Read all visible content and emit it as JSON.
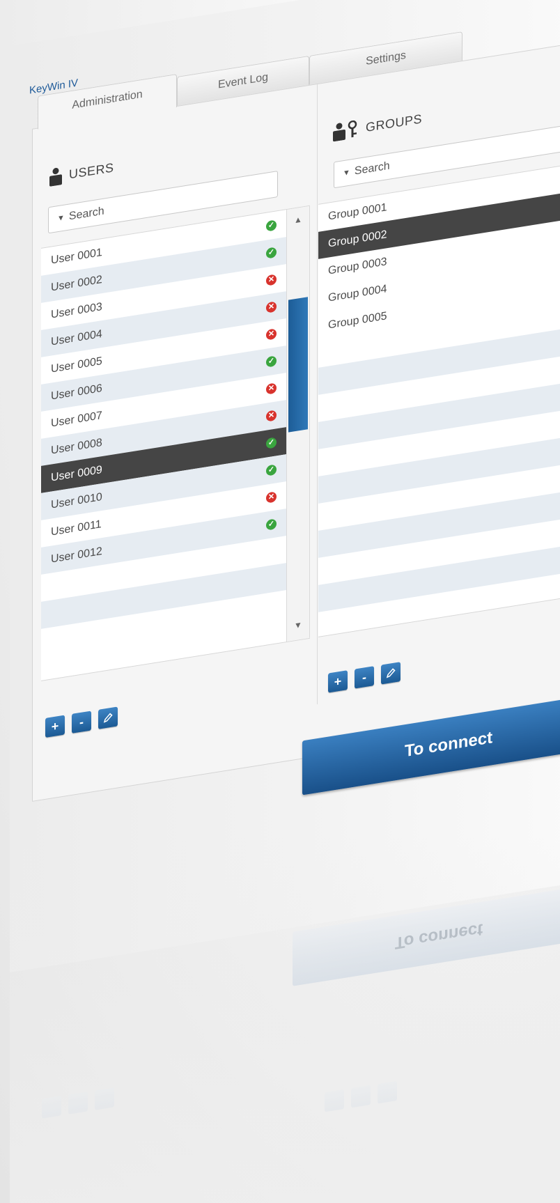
{
  "app": {
    "title": "KeyWin IV"
  },
  "tabs": [
    {
      "label": "Administration",
      "active": true
    },
    {
      "label": "Event Log",
      "active": false
    },
    {
      "label": "Settings",
      "active": false
    }
  ],
  "users": {
    "heading": "USERS",
    "search_placeholder": "Search",
    "items": [
      {
        "label": "User 0001",
        "status": "ok"
      },
      {
        "label": "User 0002",
        "status": "ok"
      },
      {
        "label": "User 0003",
        "status": "error"
      },
      {
        "label": "User 0004",
        "status": "error"
      },
      {
        "label": "User 0005",
        "status": "error"
      },
      {
        "label": "User 0006",
        "status": "ok"
      },
      {
        "label": "User 0007",
        "status": "error"
      },
      {
        "label": "User 0008",
        "status": "error"
      },
      {
        "label": "User 0009",
        "status": "ok",
        "selected": true
      },
      {
        "label": "User 0010",
        "status": "ok"
      },
      {
        "label": "User 0011",
        "status": "error"
      },
      {
        "label": "User 0012",
        "status": "ok"
      }
    ],
    "empty_rows": 3,
    "scroll_up": "▲",
    "scroll_down": "▼"
  },
  "groups": {
    "heading": "GROUPS",
    "search_placeholder": "Search",
    "items": [
      {
        "label": "Group 0001"
      },
      {
        "label": "Group 0002",
        "selected": true
      },
      {
        "label": "Group 0003"
      },
      {
        "label": "Group 0004"
      },
      {
        "label": "Group 0005"
      }
    ],
    "empty_rows": 10
  },
  "actions": {
    "add_icon": "plus-icon",
    "remove_icon": "minus-icon",
    "edit_icon": "pencil-icon",
    "add_symbol": "+",
    "remove_symbol": "-"
  },
  "connect_label": "To connect",
  "colors": {
    "accent": "#1e5a99",
    "selected_row": "#454545",
    "alt_row": "#e6ecf2",
    "ok": "#3aa53f",
    "error": "#d8332d"
  }
}
